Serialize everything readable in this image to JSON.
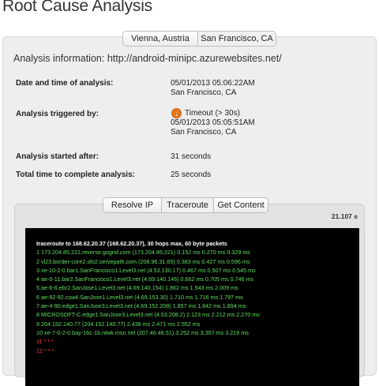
{
  "page": {
    "title": "Root Cause Analysis"
  },
  "location_tabs": [
    {
      "label": "Vienna, Austria",
      "selected": false
    },
    {
      "label": "San Francisco, CA",
      "selected": true
    }
  ],
  "analysis": {
    "info_label": "Analysis information:",
    "url": "http://android-minipc.azurewebsites.net/",
    "rows": [
      {
        "label": "Date and time of analysis:",
        "lines": [
          "05/01/2013 05:06:22AM",
          "San Francisco, CA"
        ]
      },
      {
        "label": "Analysis triggered by:",
        "trigger": "Timeout (> 30s)",
        "lines": [
          "05/01/2013 05:05:51AM",
          "San Francisco, CA"
        ]
      },
      {
        "label": "Analysis started after:",
        "lines": [
          "31 seconds"
        ]
      },
      {
        "label": "Total time to complete analysis:",
        "lines": [
          "25 seconds"
        ]
      }
    ]
  },
  "icons": {
    "timeout": "orange-down-arrow-icon"
  },
  "colors": {
    "terminal_bg": "#000000",
    "hop_ok": "#5fe05f",
    "hop_fail": "#ff3b3b",
    "timeout_icon": "#e8781e"
  },
  "tool_tabs": [
    {
      "label": "Resolve IP",
      "selected": false
    },
    {
      "label": "Traceroute",
      "selected": true
    },
    {
      "label": "Get Content",
      "selected": false
    }
  ],
  "traceroute": {
    "timing": "21.107 s",
    "header": "traceroute to 168.62.20.37 (168.62.20.37), 30 hops max, 60 byte packets",
    "hops": [
      {
        "text": "1 173.204.85.221.reverse.gogrid.com (173.204.85.221) 0.152 ms 0.270 ms 0.329 ms",
        "status": "ok"
      },
      {
        "text": "2 vl23.border-core2.sfo2.servepath.com (208.96.31.65) 0.383 ms 0.427 ms 0.596 ms",
        "status": "ok"
      },
      {
        "text": "3 xe-10-2-0.bar1.SanFrancisco1.Level3.net (4.53.130.17) 0.467 ms 0.507 ms 0.545 ms",
        "status": "ok"
      },
      {
        "text": "4 ae-0-11.bar2.SanFrancisco1.Level3.net (4.69.140.146) 0.662 ms 0.705 ms 0.746 ms",
        "status": "ok"
      },
      {
        "text": "5 ae-6-6.ebr2.SanJose1.Level3.net (4.69.140.154) 1.862 ms 1.943 ms 2.009 ms",
        "status": "ok"
      },
      {
        "text": "6 ae-92-92.csw4.SanJose1.Level3.net (4.69.153.30) 1.710 ms 1.716 ms 1.797 ms",
        "status": "ok"
      },
      {
        "text": "7 ae-4-90.edge1.SanJose3.Level3.net (4.69.152.208) 1.857 ms 1.842 ms 1.894 ms",
        "status": "ok"
      },
      {
        "text": "8 MICROSOFT-C.edge1.SanJose3.Level3.net (4.53.208.2) 2.123 ms 2.212 ms 2.270 ms",
        "status": "ok"
      },
      {
        "text": "9 204.152.140.77 (204.152.140.77) 2.438 ms 2.471 ms 2.552 ms",
        "status": "ok"
      },
      {
        "text": "10 xe-7-0-2-0.bay-16c-1b.ntwk.msn.net (207.46.46.51) 3.252 ms 3.357 ms 3.219 ms",
        "status": "ok"
      },
      {
        "text": "11 * * *",
        "status": "fail"
      },
      {
        "text": "12 * * *",
        "status": "fail"
      }
    ]
  }
}
